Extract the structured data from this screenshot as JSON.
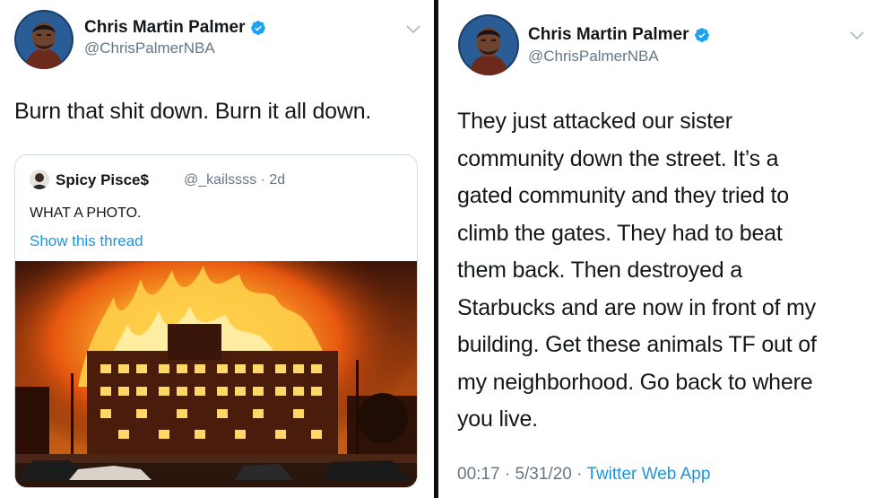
{
  "colors": {
    "link": "#1b95e0",
    "muted": "#657786",
    "text": "#14171a",
    "verified": "#1da1f2"
  },
  "left_tweet": {
    "author": {
      "name": "Chris Martin Palmer",
      "handle": "@ChrisPalmerNBA",
      "verified": true
    },
    "text": "Burn that shit down. Burn it all down.",
    "menu_icon": "chevron-down-icon",
    "quote": {
      "author_name": "Spicy Pisce$",
      "meta": "@_kailssss · 2d",
      "text": "WHAT A PHOTO.",
      "link": "Show this thread",
      "image": "burning-apartment-building"
    }
  },
  "right_tweet": {
    "author": {
      "name": "Chris Martin Palmer",
      "handle": "@ChrisPalmerNBA",
      "verified": true
    },
    "menu_icon": "chevron-down-icon",
    "text_lines": [
      "They just attacked our sister",
      "community down the street. It’s a",
      "gated community and they tried to",
      "climb the gates. They had to beat",
      "them back. Then destroyed a",
      "Starbucks and are now in front of my",
      "building. Get these animals TF out of",
      "my neighborhood. Go back to where",
      "you live."
    ],
    "time": "00:17",
    "date": "5/31/20",
    "separator": " · ",
    "source": "Twitter Web App"
  }
}
